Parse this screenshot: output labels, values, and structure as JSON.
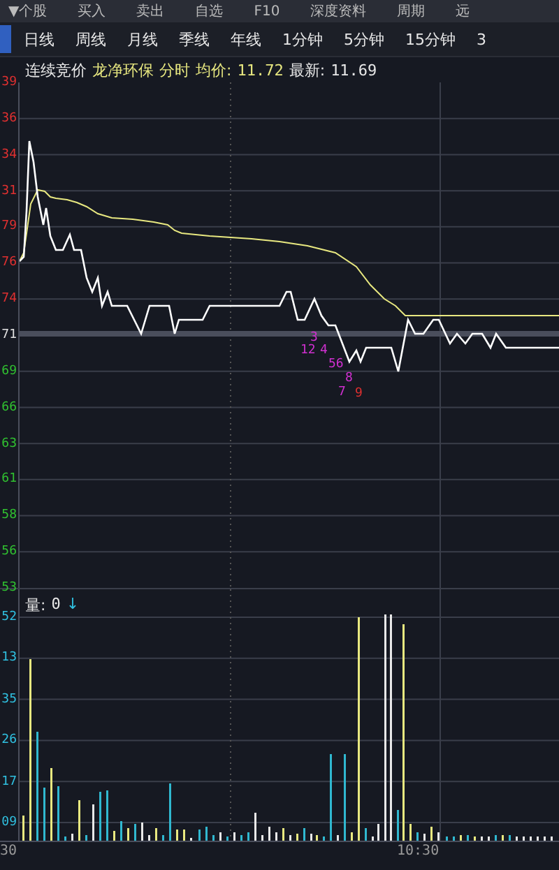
{
  "top_menu": [
    "▼个股",
    "买入",
    "卖出",
    "自选",
    "F10",
    "深度资料",
    "周期",
    "远"
  ],
  "period_tabs": [
    {
      "label": "日线",
      "selected": false
    },
    {
      "label": "周线",
      "selected": false
    },
    {
      "label": "月线",
      "selected": false
    },
    {
      "label": "季线",
      "selected": false
    },
    {
      "label": "年线",
      "selected": false
    },
    {
      "label": "1分钟",
      "selected": false
    },
    {
      "label": "5分钟",
      "selected": false
    },
    {
      "label": "15分钟",
      "selected": false
    },
    {
      "label": "3",
      "selected": false
    }
  ],
  "info": {
    "phase": "连续竞价",
    "stock": "龙净环保",
    "mode": "分时",
    "avg_label": "均价:",
    "avg": "11.72",
    "last_label": "最新:",
    "last": "11.69"
  },
  "price_axis": [
    {
      "label": "39",
      "color": "#e03030"
    },
    {
      "label": "36",
      "color": "#e03030"
    },
    {
      "label": "34",
      "color": "#e03030"
    },
    {
      "label": "31",
      "color": "#e03030"
    },
    {
      "label": "79",
      "color": "#e03030"
    },
    {
      "label": "76",
      "color": "#e03030"
    },
    {
      "label": "74",
      "color": "#e03030"
    },
    {
      "label": "71",
      "color": "#e0e0e0"
    },
    {
      "label": "69",
      "color": "#30c030"
    },
    {
      "label": "66",
      "color": "#30c030"
    },
    {
      "label": "63",
      "color": "#30c030"
    },
    {
      "label": "61",
      "color": "#30c030"
    },
    {
      "label": "58",
      "color": "#30c030"
    },
    {
      "label": "56",
      "color": "#30c030"
    },
    {
      "label": "53",
      "color": "#30c030"
    }
  ],
  "signals": [
    {
      "text": "3",
      "color": "#d030d0"
    },
    {
      "text": "12",
      "color": "#d030d0"
    },
    {
      "text": "4",
      "color": "#d030d0"
    },
    {
      "text": "56",
      "color": "#d030d0"
    },
    {
      "text": "8",
      "color": "#d030d0"
    },
    {
      "text": "7",
      "color": "#d030d0"
    },
    {
      "text": "9",
      "color": "#e03030"
    }
  ],
  "volume": {
    "label": "量:",
    "value": "0",
    "arrow": "↓"
  },
  "volume_axis": [
    "52",
    "13",
    "35",
    "26",
    "17",
    "09"
  ],
  "time_axis": [
    "30",
    "10:30"
  ]
}
